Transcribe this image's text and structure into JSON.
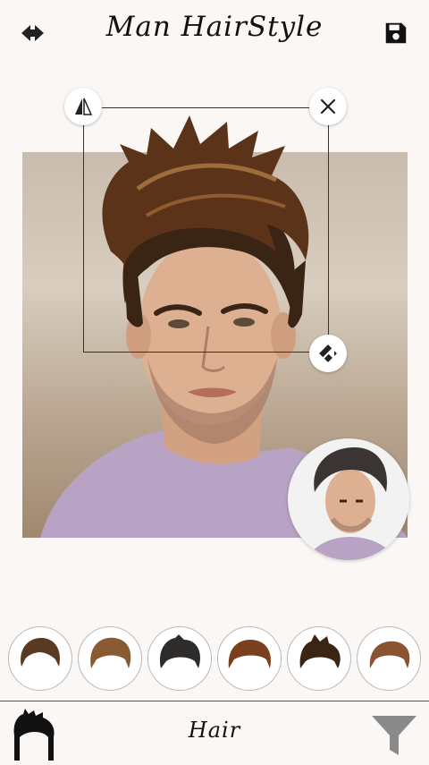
{
  "header": {
    "title": "Man HairStyle",
    "back_icon": "back-arrow-icon",
    "save_icon": "save-disk-icon"
  },
  "editor": {
    "flip_icon": "flip-horizontal-icon",
    "close_icon": "close-icon",
    "resize_icon": "resize-rotate-icon"
  },
  "hairstyles": [
    {
      "name": "hairstyle-1",
      "color": "#5a3a22"
    },
    {
      "name": "hairstyle-2",
      "color": "#8a5a32"
    },
    {
      "name": "hairstyle-3",
      "color": "#2e2c2a"
    },
    {
      "name": "hairstyle-4",
      "color": "#7a3f1c"
    },
    {
      "name": "hairstyle-5",
      "color": "#3a2414"
    },
    {
      "name": "hairstyle-6",
      "color": "#8b5430"
    }
  ],
  "bottom_bar": {
    "category_label": "Hair",
    "category_icon": "hair-silhouette-icon",
    "filter_icon": "filter-funnel-icon"
  },
  "colors": {
    "background": "#faf7f5",
    "text": "#111111",
    "hair_overlay": "#5b3318"
  }
}
